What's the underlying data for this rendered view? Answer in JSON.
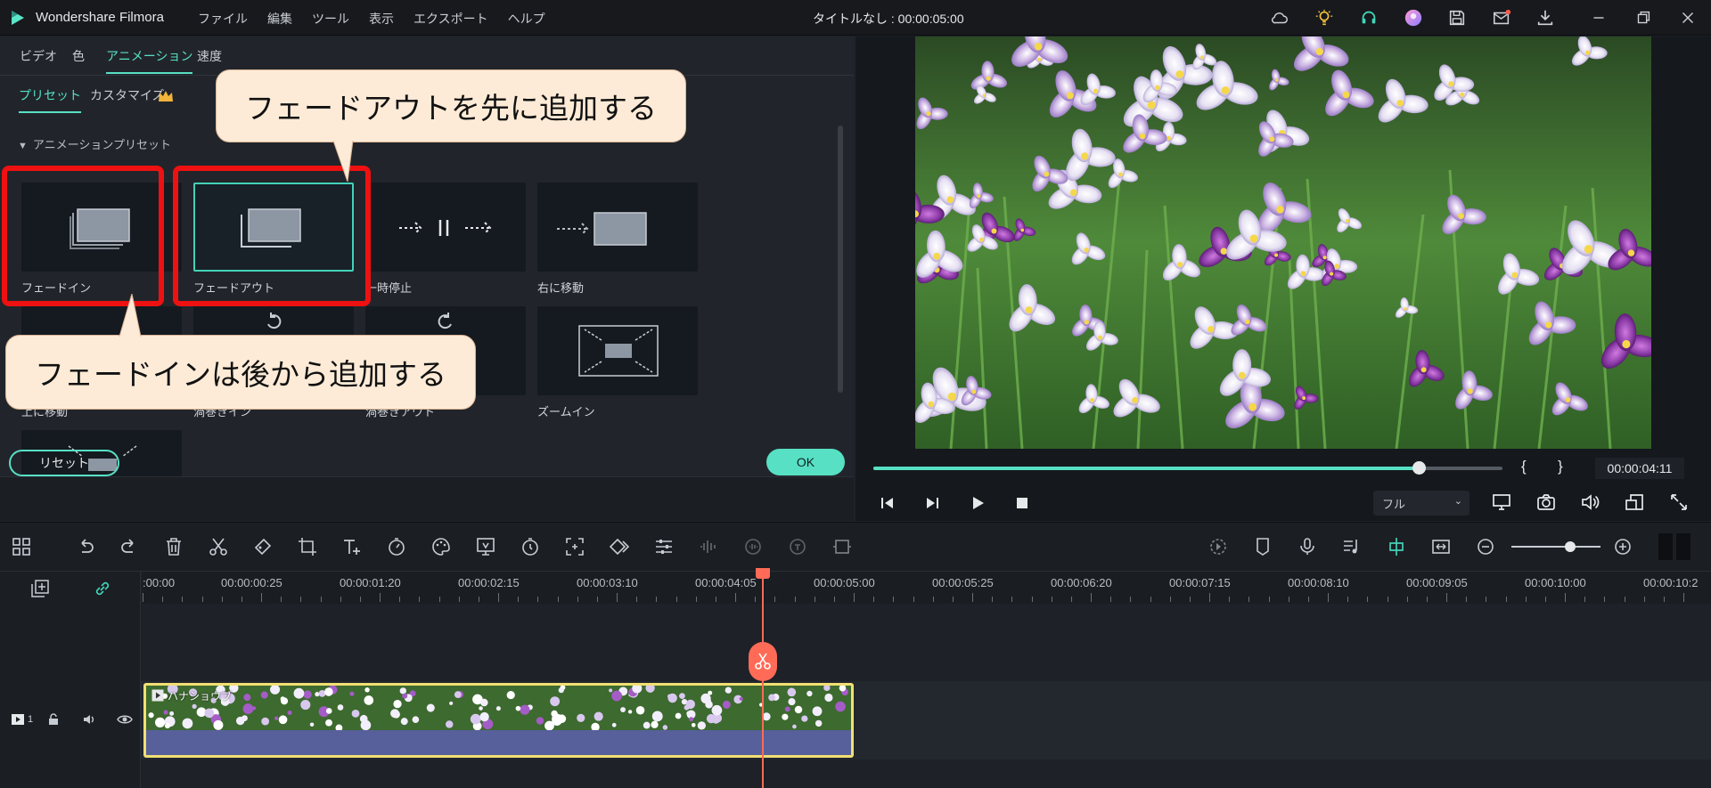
{
  "titlebar": {
    "app_name": "Wondershare Filmora",
    "menu": [
      "ファイル",
      "編集",
      "ツール",
      "表示",
      "エクスポート",
      "ヘルプ"
    ],
    "project_title": "タイトルなし : 00:00:05:00",
    "icons": [
      "cloud-icon",
      "bulb-icon",
      "headset-icon",
      "avatar-icon",
      "save-icon",
      "mail-icon",
      "download-icon",
      "minimize-icon",
      "restore-icon",
      "close-icon"
    ]
  },
  "panel_tabs": [
    "ビデオ",
    "色",
    "アニメーション",
    "速度"
  ],
  "sub_tabs": {
    "preset": "プリセット",
    "customize": "カスタマイズ"
  },
  "presets_header": "アニメーションプリセット",
  "presets": [
    {
      "label": "フェードイン"
    },
    {
      "label": "フェードアウト"
    },
    {
      "label": "一時停止"
    },
    {
      "label": "右に移動"
    },
    {
      "label": "上に移動"
    },
    {
      "label": "渦巻きイン"
    },
    {
      "label": "渦巻きアウト"
    },
    {
      "label": "ズームイン"
    }
  ],
  "buttons": {
    "reset": "リセット",
    "ok": "OK"
  },
  "callouts": {
    "fade_out_first": "フェードアウトを先に追加する",
    "fade_in_later": "フェードインは後から追加する"
  },
  "player": {
    "timecode": "00:00:04:11",
    "quality": "フル",
    "brackets": [
      "{",
      "}"
    ],
    "progress": 0.867
  },
  "timeline": {
    "ruler_labels": [
      ":00:00",
      "00:00:00:25",
      "00:00:01:20",
      "00:00:02:15",
      "00:00:03:10",
      "00:00:04:05",
      "00:00:05:00",
      "00:00:05:25",
      "00:00:06:20",
      "00:00:07:15",
      "00:00:08:10",
      "00:00:09:05",
      "00:00:10:00",
      "00:00:10:2"
    ],
    "clip_name": "ハナショウブ",
    "track_number": "1"
  },
  "colors": {
    "accent": "#57e0c4",
    "highlight": "#ee1111",
    "playhead": "#ff6b57",
    "clip_border": "#f2df72"
  }
}
